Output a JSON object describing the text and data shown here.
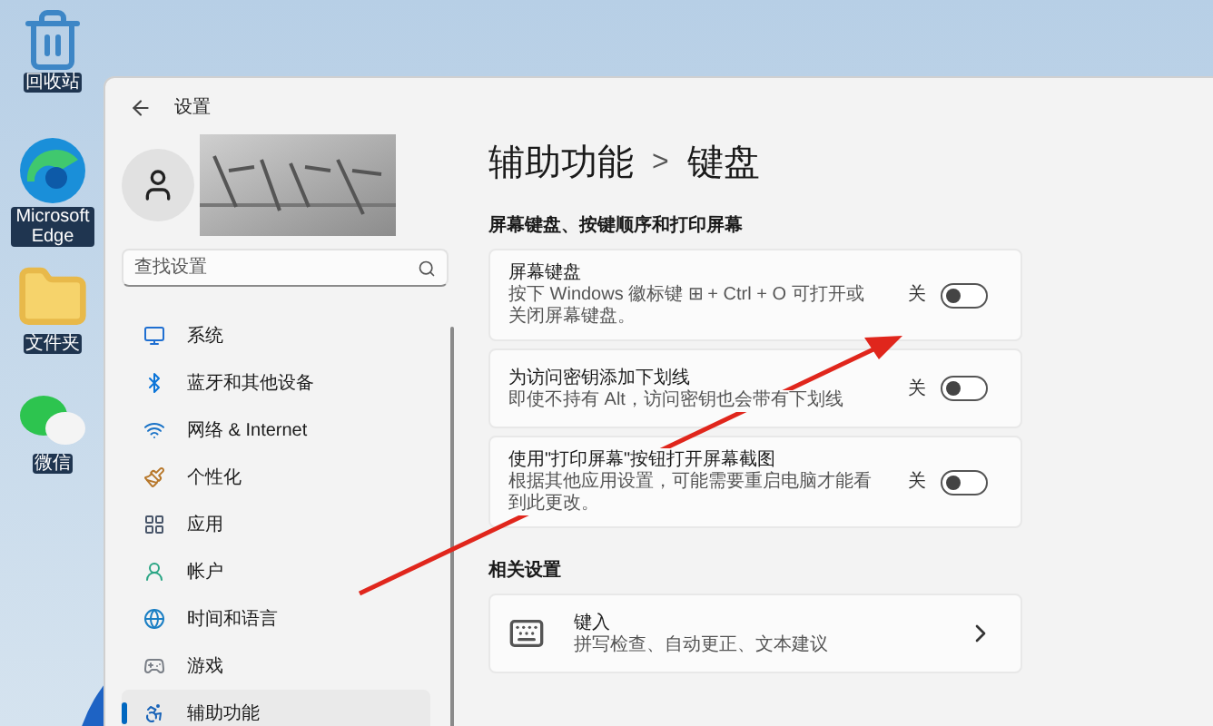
{
  "desktop_icons": [
    {
      "kind": "recycle",
      "label": "回收站"
    },
    {
      "kind": "edge",
      "label": "Microsoft Edge"
    },
    {
      "kind": "folder",
      "label": "文件夹"
    },
    {
      "kind": "chat",
      "label": "微信"
    }
  ],
  "window": {
    "title": "设置"
  },
  "sidebar": {
    "search": {
      "placeholder": "查找设置"
    },
    "items": [
      {
        "kind": "system",
        "label": "系统",
        "selected": false
      },
      {
        "kind": "bluetooth",
        "label": "蓝牙和其他设备",
        "selected": false
      },
      {
        "kind": "network",
        "label": "网络 & Internet",
        "selected": false
      },
      {
        "kind": "personalize",
        "label": "个性化",
        "selected": false
      },
      {
        "kind": "apps",
        "label": "应用",
        "selected": false
      },
      {
        "kind": "account",
        "label": "帐户",
        "selected": false
      },
      {
        "kind": "time",
        "label": "时间和语言",
        "selected": false
      },
      {
        "kind": "gaming",
        "label": "游戏",
        "selected": false
      },
      {
        "kind": "accessibility",
        "label": "辅助功能",
        "selected": true
      }
    ]
  },
  "page": {
    "breadcrumb": [
      "辅助功能",
      "键盘"
    ],
    "separator": ">"
  },
  "sections": [
    {
      "title": "屏幕键盘、按键顺序和打印屏幕",
      "cards": [
        {
          "kind": "toggle",
          "title": "屏幕键盘",
          "description": "按下 Windows 徽标键 ⊞ + Ctrl + O 可打开或关闭屏幕键盘。",
          "state_label": "关",
          "on": false
        },
        {
          "kind": "toggle",
          "title": "为访问密钥添加下划线",
          "description": "即使不持有 Alt，访问密钥也会带有下划线",
          "state_label": "关",
          "on": false
        },
        {
          "kind": "toggle",
          "title": "使用\"打印屏幕\"按钮打开屏幕截图",
          "description": "根据其他应用设置，可能需要重启电脑才能看到此更改。",
          "state_label": "关",
          "on": false
        }
      ]
    },
    {
      "title": "相关设置",
      "cards": [
        {
          "kind": "link",
          "title": "键入",
          "description": "拼写检查、自动更正、文本建议"
        }
      ]
    }
  ]
}
